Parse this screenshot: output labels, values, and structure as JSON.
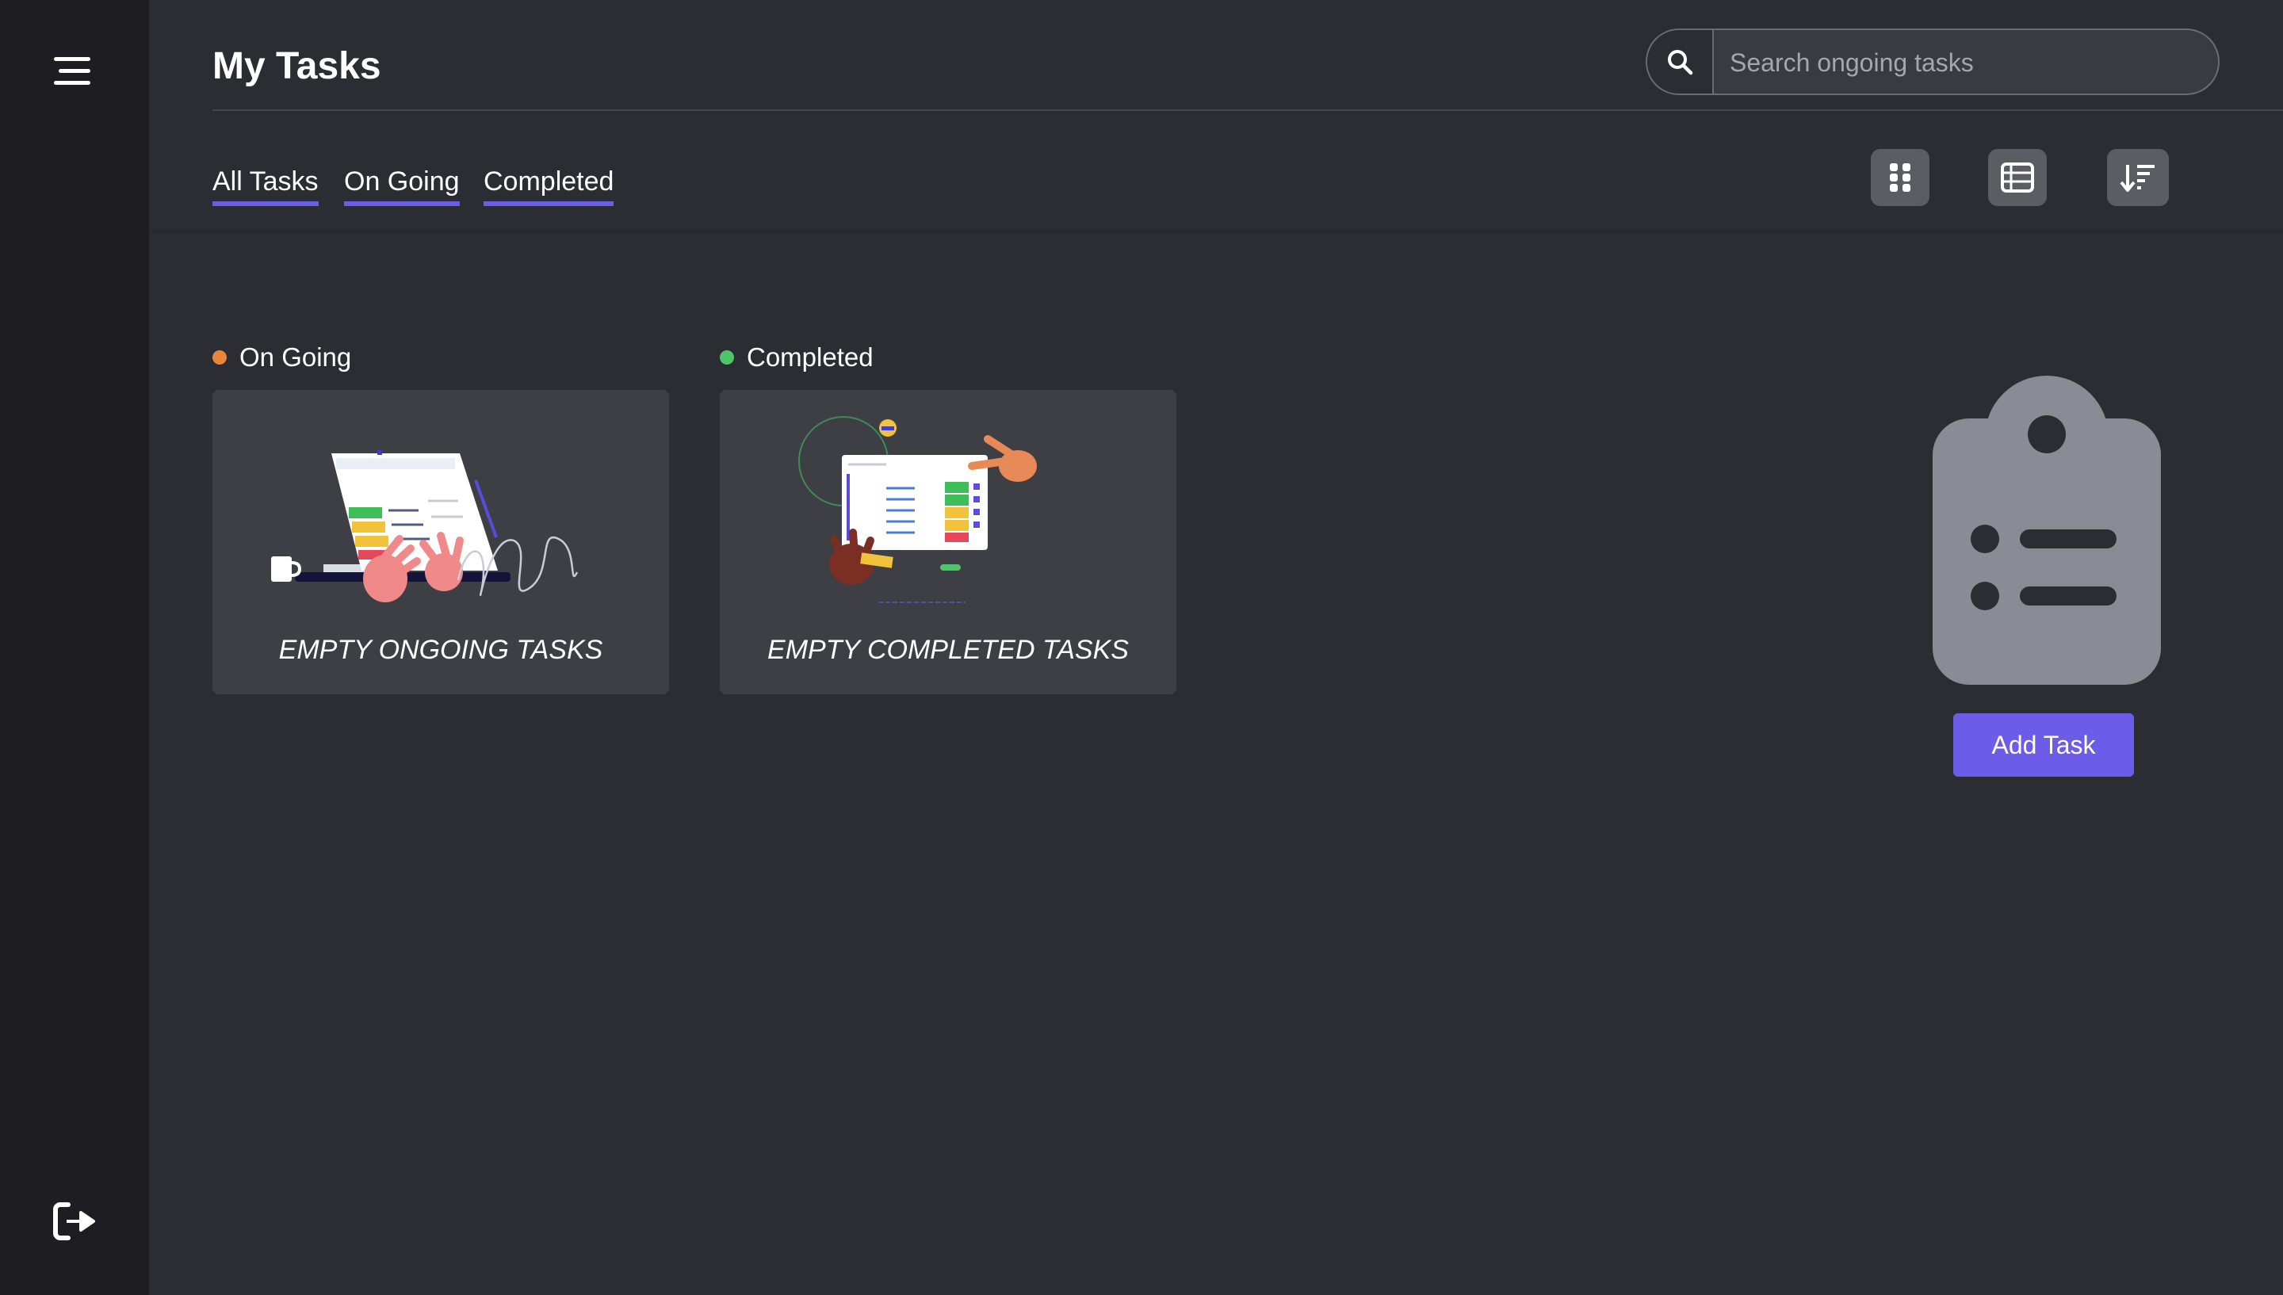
{
  "header": {
    "title": "My Tasks",
    "search_placeholder": "Search ongoing tasks",
    "search_value": ""
  },
  "tabs": [
    {
      "label": "All Tasks"
    },
    {
      "label": "On Going"
    },
    {
      "label": "Completed"
    }
  ],
  "view_buttons": [
    {
      "icon": "grid-icon"
    },
    {
      "icon": "list-icon"
    },
    {
      "icon": "sort-icon"
    }
  ],
  "sections": {
    "ongoing": {
      "label": "On Going",
      "empty_text": "EMPTY ONGOING TASKS",
      "dot_color": "#e8873a"
    },
    "completed": {
      "label": "Completed",
      "empty_text": "EMPTY COMPLETED TASKS",
      "dot_color": "#4fc46a"
    }
  },
  "empty_state": {
    "icon": "clipboard-list-icon",
    "button_label": "Add Task"
  },
  "sidebar": {
    "menu_icon": "menu-icon",
    "logout_icon": "logout-icon"
  },
  "colors": {
    "accent": "#6c5ce7",
    "background": "#2c2d33",
    "sidebar": "#1e1e22",
    "card": "#3e3f45"
  }
}
